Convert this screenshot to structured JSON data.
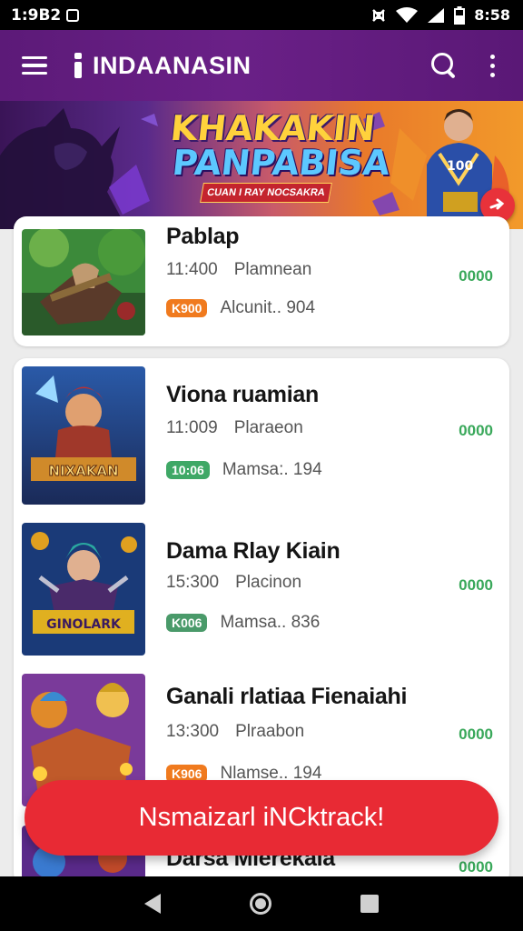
{
  "status_bar": {
    "time_left": "1:9B2",
    "time_right": "8:58"
  },
  "app_bar": {
    "title": "INDAANASIN"
  },
  "banner": {
    "title_line1": "KHAKAKIN",
    "title_line2": "PANPABISA",
    "subtitle": "CUAN I RAY NOCSAKRA",
    "colors": {
      "yellow": "#ffd23c",
      "blue": "#5cc8ff",
      "red": "#c4242e"
    }
  },
  "games": [
    {
      "name": "Pablap",
      "time": "11:400",
      "category": "Plamnean",
      "tag": "K900",
      "tag_color": "#f07a1e",
      "sub": "Alcunit.. 904",
      "price": "0000"
    },
    {
      "name": "Viona ruamian",
      "time": "11:009",
      "category": "Plaraeon",
      "tag": "10:06",
      "tag_color": "#3fa866",
      "sub": "Mamsa:. 194",
      "price": "0000",
      "thumb_caption": "NIXAKAN"
    },
    {
      "name": "Dama Rlay Kiain",
      "time": "15:300",
      "category": "Placinon",
      "tag": "K006",
      "tag_color": "#4a9a6a",
      "sub": "Mamsa.. 836",
      "price": "0000",
      "thumb_caption": "GINOLARK"
    },
    {
      "name": "Ganali rlatiaa Fienaiahi",
      "time": "13:300",
      "category": "Plraabon",
      "tag": "K906",
      "tag_color": "#f07a1e",
      "sub": "Nlamse.. 194",
      "price": "0000"
    },
    {
      "name": "Darsa Mlerekala",
      "price": "0000"
    }
  ],
  "cta": {
    "label": "Nsmaizarl iNCktrack!"
  },
  "theme": {
    "app_bar": "#5c1a78",
    "accent": "#e82a34",
    "price_green": "#39a85a"
  }
}
